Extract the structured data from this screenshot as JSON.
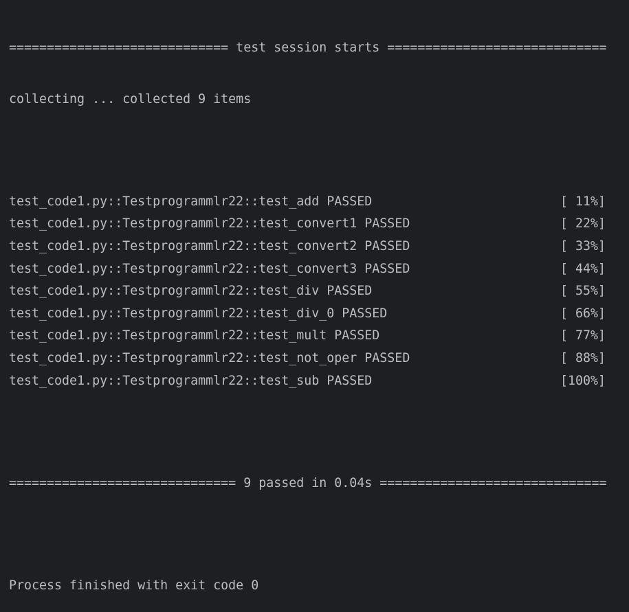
{
  "colors": {
    "background": "#1e1f22",
    "text": "#bcbec4"
  },
  "header": "============================= test session starts =============================",
  "collecting": "collecting ... collected 9 items",
  "results": [
    {
      "test": "test_code1.py::Testprogrammlr22::test_add PASSED",
      "progress": "[ 11%]"
    },
    {
      "test": "test_code1.py::Testprogrammlr22::test_convert1 PASSED",
      "progress": "[ 22%]"
    },
    {
      "test": "test_code1.py::Testprogrammlr22::test_convert2 PASSED",
      "progress": "[ 33%]"
    },
    {
      "test": "test_code1.py::Testprogrammlr22::test_convert3 PASSED",
      "progress": "[ 44%]"
    },
    {
      "test": "test_code1.py::Testprogrammlr22::test_div PASSED",
      "progress": "[ 55%]"
    },
    {
      "test": "test_code1.py::Testprogrammlr22::test_div_0 PASSED",
      "progress": "[ 66%]"
    },
    {
      "test": "test_code1.py::Testprogrammlr22::test_mult PASSED",
      "progress": "[ 77%]"
    },
    {
      "test": "test_code1.py::Testprogrammlr22::test_not_oper PASSED",
      "progress": "[ 88%]"
    },
    {
      "test": "test_code1.py::Testprogrammlr22::test_sub PASSED",
      "progress": "[100%]"
    }
  ],
  "summary": "============================== 9 passed in 0.04s ==============================",
  "exit": "Process finished with exit code 0"
}
